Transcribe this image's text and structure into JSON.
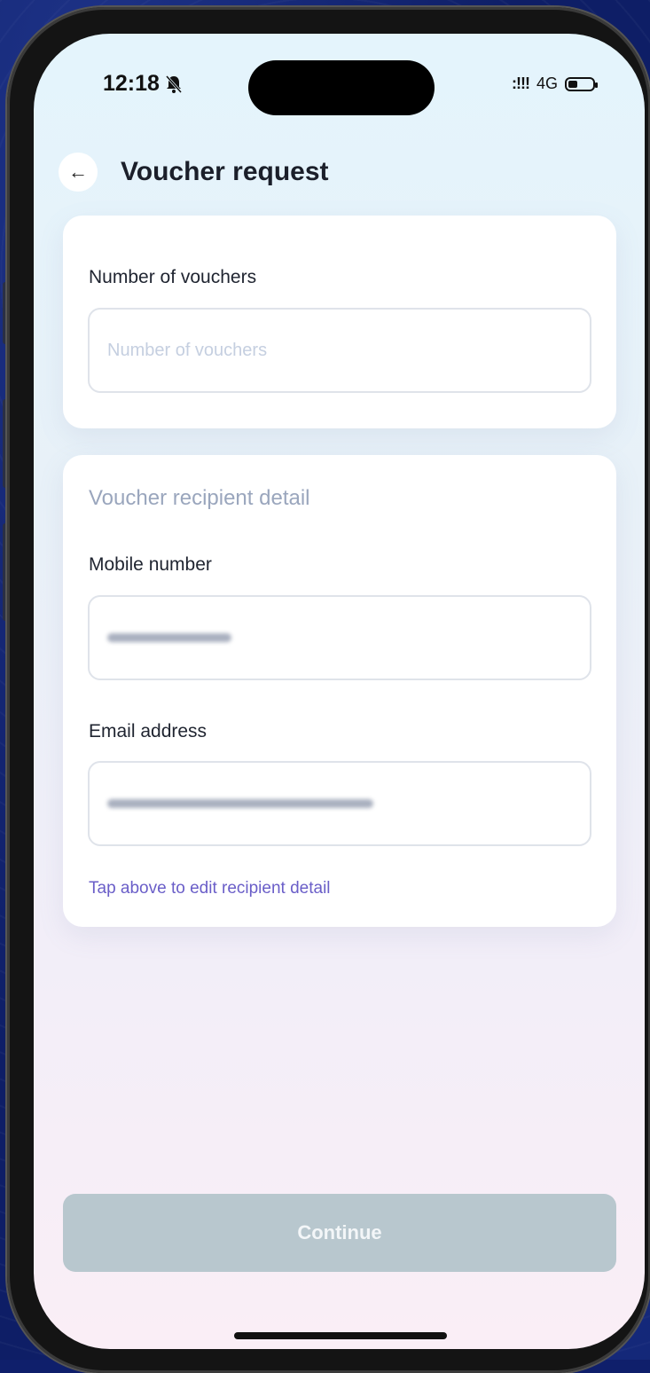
{
  "status_bar": {
    "time": "12:18",
    "network": "4G",
    "signal_glyph": ":!!!"
  },
  "header": {
    "back_icon": "←",
    "title": "Voucher request"
  },
  "vouchers_card": {
    "label": "Number of vouchers",
    "input_placeholder": "Number of vouchers"
  },
  "recipient_card": {
    "section_title": "Voucher recipient detail",
    "mobile_label": "Mobile number",
    "email_label": "Email address",
    "edit_hint": "Tap above to edit recipient detail"
  },
  "footer": {
    "continue_label": "Continue"
  },
  "colors": {
    "accent_link": "#6a5ec8",
    "button_disabled": "#b8c7ce"
  }
}
